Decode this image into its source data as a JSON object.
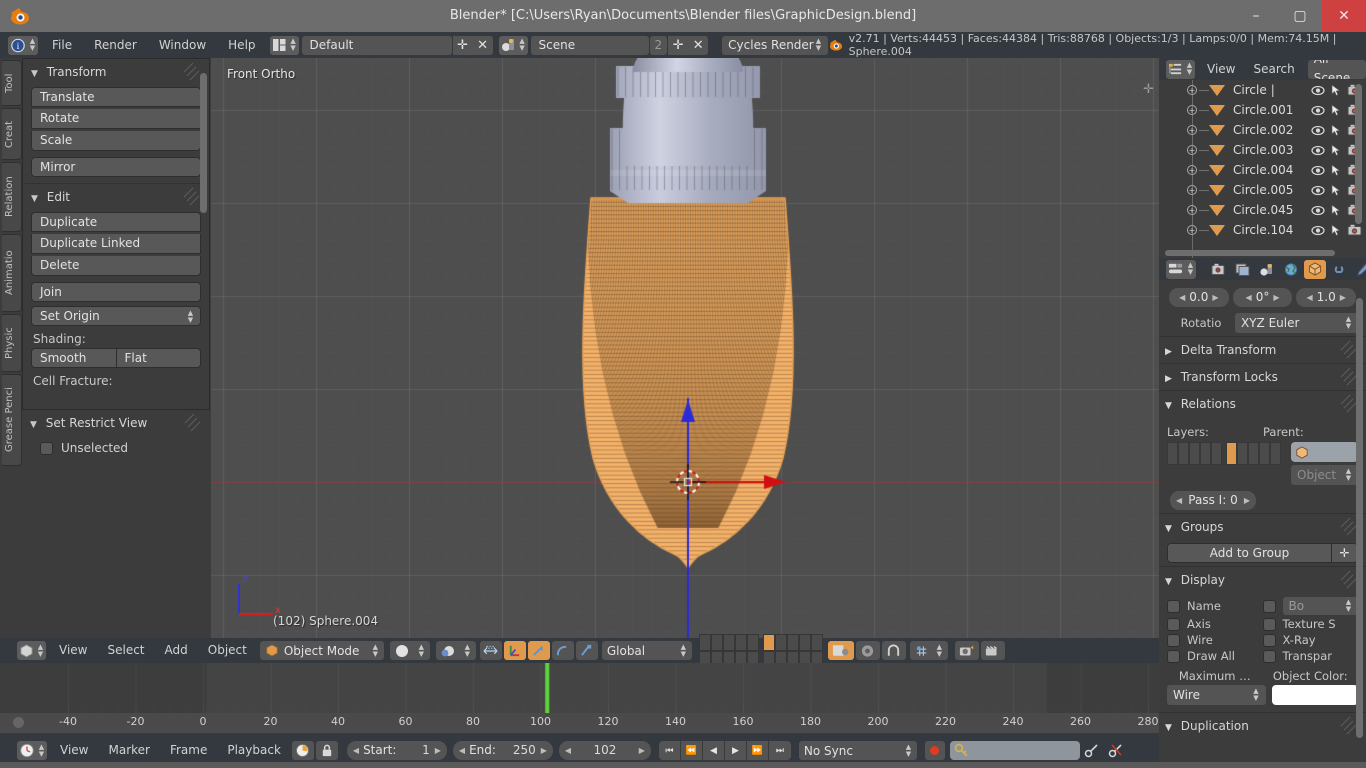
{
  "window": {
    "title": "Blender* [C:\\Users\\Ryan\\Documents\\Blender files\\GraphicDesign.blend]",
    "minimize": "–",
    "maximize": "▢",
    "close": "✕",
    "logo_icon": "blender-logo-icon"
  },
  "topbar": {
    "menus": [
      "File",
      "Render",
      "Window",
      "Help"
    ],
    "info_icon": "info-editor-icon",
    "screen_icon": "screen-layout-icon",
    "screen_layout": "Default",
    "add_label": "✛",
    "remove_label": "✕",
    "scene_icon": "scene-icon",
    "scene_name": "Scene",
    "scene_users": "2",
    "engine": "Cycles Render",
    "status": "v2.71 | Verts:44453 | Faces:44384 | Tris:88768 | Objects:1/3 | Lamps:0/0 | Mem:74.15M | Sphere.004"
  },
  "toolshelf": {
    "tabs": [
      "Tool",
      "Creat",
      "Relation",
      "Animatio",
      "Physic",
      "Grease Penci"
    ],
    "transform": {
      "title": "Transform",
      "buttons": [
        "Translate",
        "Rotate",
        "Scale"
      ],
      "mirror": "Mirror"
    },
    "edit": {
      "title": "Edit",
      "buttons": [
        "Duplicate",
        "Duplicate Linked",
        "Delete"
      ],
      "join": "Join",
      "set_origin": "Set Origin",
      "shading_label": "Shading:",
      "smooth": "Smooth",
      "flat": "Flat",
      "cell_fracture_label": "Cell Fracture:"
    },
    "restrict": {
      "title": "Set Restrict View",
      "unselected": "Unselected"
    }
  },
  "viewport": {
    "view_label": "Front Ortho",
    "object_label": "(102) Sphere.004",
    "axis_x": "x",
    "axis_z": "z",
    "bg_color": "#4e4e4e",
    "select_color": "#f4b26a",
    "cap_color": "#b8bcd0"
  },
  "viewport_footer": {
    "editor_icon": "3d-view-editor-icon",
    "menus": [
      "View",
      "Select",
      "Add",
      "Object"
    ],
    "mode_icon": "object-mode-icon",
    "mode": "Object Mode",
    "shading_icon": "solid-shading-icon",
    "pivot_icon": "pivot-median-icon",
    "manipulator_icons": [
      "translate-manipulator-icon",
      "rotate-manipulator-icon",
      "scale-manipulator-icon"
    ],
    "orientation": "Global",
    "snap_icon": "snap-magnet-icon",
    "proportional_icon": "proportional-edit-icon",
    "render_icon": "render-preview-icon",
    "camera_icon": "viewport-render-icon"
  },
  "timeline": {
    "editor_icon": "timeline-editor-icon",
    "menus": [
      "View",
      "Marker",
      "Frame",
      "Playback"
    ],
    "auto_key_icon": "auto-keying-icon",
    "lock_icon": "lock-icon",
    "start_label": "Start:",
    "start_value": "1",
    "end_label": "End:",
    "end_value": "250",
    "current_frame": "102",
    "playback": [
      "jump-start-icon",
      "prev-keyframe-icon",
      "play-reverse-icon",
      "play-icon",
      "next-keyframe-icon",
      "jump-end-icon"
    ],
    "sync_mode": "No Sync",
    "record_icon": "record-icon",
    "keying_set_icon": "keying-set-icon",
    "insert_key_icon": "insert-keyframe-icon",
    "delete_key_icon": "delete-keyframe-icon",
    "ruler_ticks": [
      "-40",
      "-20",
      "0",
      "20",
      "40",
      "60",
      "80",
      "100",
      "120",
      "140",
      "160",
      "180",
      "200",
      "220",
      "240",
      "260",
      "280"
    ],
    "playhead_frame": "102",
    "playhead_color": "#5fd43c"
  },
  "outliner": {
    "editor_icon": "outliner-editor-icon",
    "menus": [
      "View",
      "Search"
    ],
    "display_mode": "All Scene",
    "rows": [
      {
        "name": "Circle"
      },
      {
        "name": "Circle.001"
      },
      {
        "name": "Circle.002"
      },
      {
        "name": "Circle.003"
      },
      {
        "name": "Circle.004"
      },
      {
        "name": "Circle.005"
      },
      {
        "name": "Circle.045"
      },
      {
        "name": "Circle.104"
      }
    ],
    "row_icons": [
      "eye-icon",
      "cursor-arrow-icon",
      "camera-icon"
    ]
  },
  "properties": {
    "editor_icon": "properties-editor-icon",
    "tabs": [
      {
        "icon": "render-tab-icon",
        "active": false
      },
      {
        "icon": "render-layers-tab-icon",
        "active": false
      },
      {
        "icon": "scene-tab-icon",
        "active": false
      },
      {
        "icon": "world-tab-icon",
        "active": false
      },
      {
        "icon": "object-tab-icon",
        "active": true
      },
      {
        "icon": "constraints-tab-icon",
        "active": false
      },
      {
        "icon": "modifiers-tab-icon",
        "active": false
      }
    ],
    "top_values": [
      "0.0",
      "0°",
      "1.0"
    ],
    "rotation_label": "Rotatio",
    "rotation_mode": "XYZ Euler",
    "delta_transform": "Delta Transform",
    "transform_locks": "Transform Locks",
    "relations": {
      "title": "Relations",
      "layers_label": "Layers:",
      "parent_label": "Parent:",
      "parent_value": "",
      "parent_type": "Object",
      "pass_index": "Pass I:  0"
    },
    "groups": {
      "title": "Groups",
      "add_to_group": "Add to Group",
      "plus": "✛"
    },
    "display": {
      "title": "Display",
      "checkboxes_left": [
        "Name",
        "Axis",
        "Wire",
        "Draw All"
      ],
      "checkboxes_right": [
        "",
        "Texture S",
        "X-Ray",
        "Transpar"
      ],
      "bo_value": "Bo",
      "maximum_label": "Maximum …",
      "object_color_label": "Object Color:",
      "draw_type": "Wire",
      "object_color": "#ffffff"
    },
    "duplication": "Duplication"
  }
}
